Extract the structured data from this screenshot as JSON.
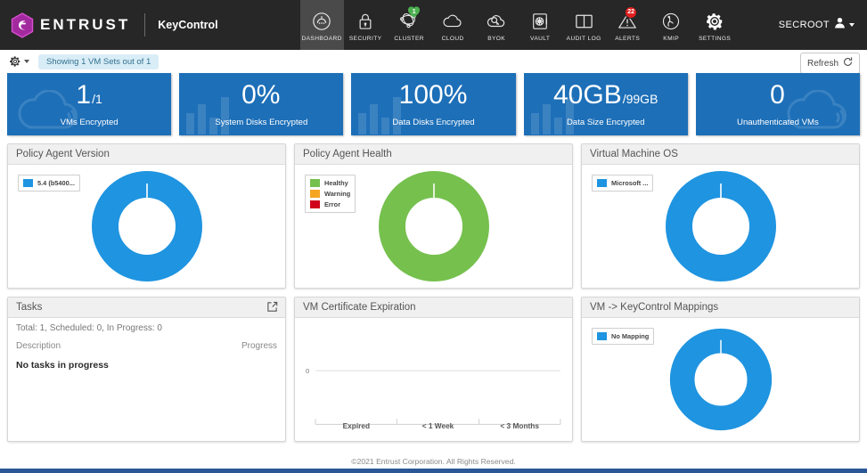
{
  "brand": {
    "logo_icon": "entrust-hexagon-logo",
    "name": "ENTRUST",
    "product": "KeyControl",
    "logo_color": "#b43cb0"
  },
  "nav": {
    "items": [
      {
        "label": "DASHBOARD",
        "icon": "dashboard-gauge-icon",
        "active": true,
        "badge": ""
      },
      {
        "label": "SECURITY",
        "icon": "lock-icon",
        "active": false,
        "badge": ""
      },
      {
        "label": "CLUSTER",
        "icon": "cluster-nodes-icon",
        "active": false,
        "badge": "1",
        "badge_type": "heart",
        "badge_color": "#4caf50"
      },
      {
        "label": "CLOUD",
        "icon": "cloud-icon",
        "active": false,
        "badge": ""
      },
      {
        "label": "BYOK",
        "icon": "cloud-key-icon",
        "active": false,
        "badge": ""
      },
      {
        "label": "VAULT",
        "icon": "vault-safe-icon",
        "active": false,
        "badge": ""
      },
      {
        "label": "AUDIT LOG",
        "icon": "book-open-icon",
        "active": false,
        "badge": ""
      },
      {
        "label": "ALERTS",
        "icon": "warning-triangle-icon",
        "active": false,
        "badge": "22",
        "badge_type": "circle",
        "badge_color": "#e02020"
      },
      {
        "label": "KMIP",
        "icon": "kmip-icon",
        "active": false,
        "badge": ""
      },
      {
        "label": "SETTINGS",
        "icon": "gear-icon",
        "active": false,
        "badge": ""
      }
    ],
    "user": {
      "name": "SECROOT",
      "icon": "user-icon"
    }
  },
  "subbar": {
    "gear_icon": "gear-dropdown-icon",
    "filter_pill": "Showing 1 VM Sets out of 1",
    "refresh_label": "Refresh",
    "refresh_icon": "refresh-icon"
  },
  "kpis": [
    {
      "value": "1",
      "suffix": "/1",
      "label": "VMs Encrypted",
      "watermark": "cloud-icon",
      "watermark_side": "left"
    },
    {
      "value": "0%",
      "suffix": "",
      "label": "System Disks Encrypted",
      "watermark": "bar-chart-icon",
      "watermark_side": "left"
    },
    {
      "value": "100%",
      "suffix": "",
      "label": "Data Disks Encrypted",
      "watermark": "bar-chart-icon",
      "watermark_side": "left"
    },
    {
      "value": "40GB",
      "suffix": "/99GB",
      "label": "Data Size Encrypted",
      "watermark": "bar-chart-icon",
      "watermark_side": "left"
    },
    {
      "value": "0",
      "suffix": "",
      "label": "Unauthenticated VMs",
      "watermark": "cloud-icon",
      "watermark_side": "right"
    }
  ],
  "panels": {
    "policy_agent_version": {
      "title": "Policy Agent Version"
    },
    "policy_agent_health": {
      "title": "Policy Agent Health"
    },
    "virtual_machine_os": {
      "title": "Virtual Machine OS"
    },
    "tasks": {
      "title": "Tasks",
      "popout_icon": "external-link-icon",
      "summary": "Total: 1, Scheduled: 0, In Progress: 0",
      "col_description": "Description",
      "col_progress": "Progress",
      "empty_message": "No tasks in progress"
    },
    "vm_certificate_expiration": {
      "title": "VM Certificate Expiration"
    },
    "vm_keycontrol_mappings": {
      "title": "VM -> KeyControl Mappings"
    }
  },
  "chart_data": [
    {
      "type": "pie",
      "name": "policy-agent-version-donut",
      "title": "Policy Agent Version",
      "labels": [
        "5.4 (b5400..."
      ],
      "values": [
        1
      ],
      "colors": [
        "#1f94e0"
      ],
      "legend_position": "top-left",
      "donut": true
    },
    {
      "type": "pie",
      "name": "policy-agent-health-donut",
      "title": "Policy Agent Health",
      "labels": [
        "Healthy",
        "Warning",
        "Error"
      ],
      "values": [
        1,
        0,
        0
      ],
      "colors": [
        "#76c04e",
        "#f5a623",
        "#d0021b"
      ],
      "legend_position": "top-left",
      "donut": true
    },
    {
      "type": "pie",
      "name": "virtual-machine-os-donut",
      "title": "Virtual Machine OS",
      "labels": [
        "Microsoft ..."
      ],
      "values": [
        1
      ],
      "colors": [
        "#1f94e0"
      ],
      "legend_position": "top-left",
      "donut": true
    },
    {
      "type": "bar",
      "name": "vm-certificate-expiration-bar",
      "title": "VM Certificate Expiration",
      "categories": [
        "Expired",
        "< 1 Week",
        "< 3 Months"
      ],
      "values": [
        0,
        0,
        0
      ],
      "xlabel": "",
      "ylabel": "",
      "ylim": [
        0,
        1
      ],
      "yticks": [
        "0"
      ],
      "grid": false,
      "legend_position": "none"
    },
    {
      "type": "pie",
      "name": "vm-keycontrol-mappings-donut",
      "title": "VM -> KeyControl Mappings",
      "labels": [
        "No Mapping"
      ],
      "values": [
        1
      ],
      "colors": [
        "#1f94e0"
      ],
      "legend_position": "top-left",
      "donut": true
    }
  ],
  "footer": {
    "copyright": "©2021 Entrust Corporation. All Rights Reserved."
  },
  "theme": {
    "nav_bg": "#272727",
    "tile_blue": "#1d6fb8",
    "donut_blue": "#1f94e0",
    "health_green": "#76c04e",
    "pill_bg": "#d9edf7",
    "pill_fg": "#31708f"
  }
}
